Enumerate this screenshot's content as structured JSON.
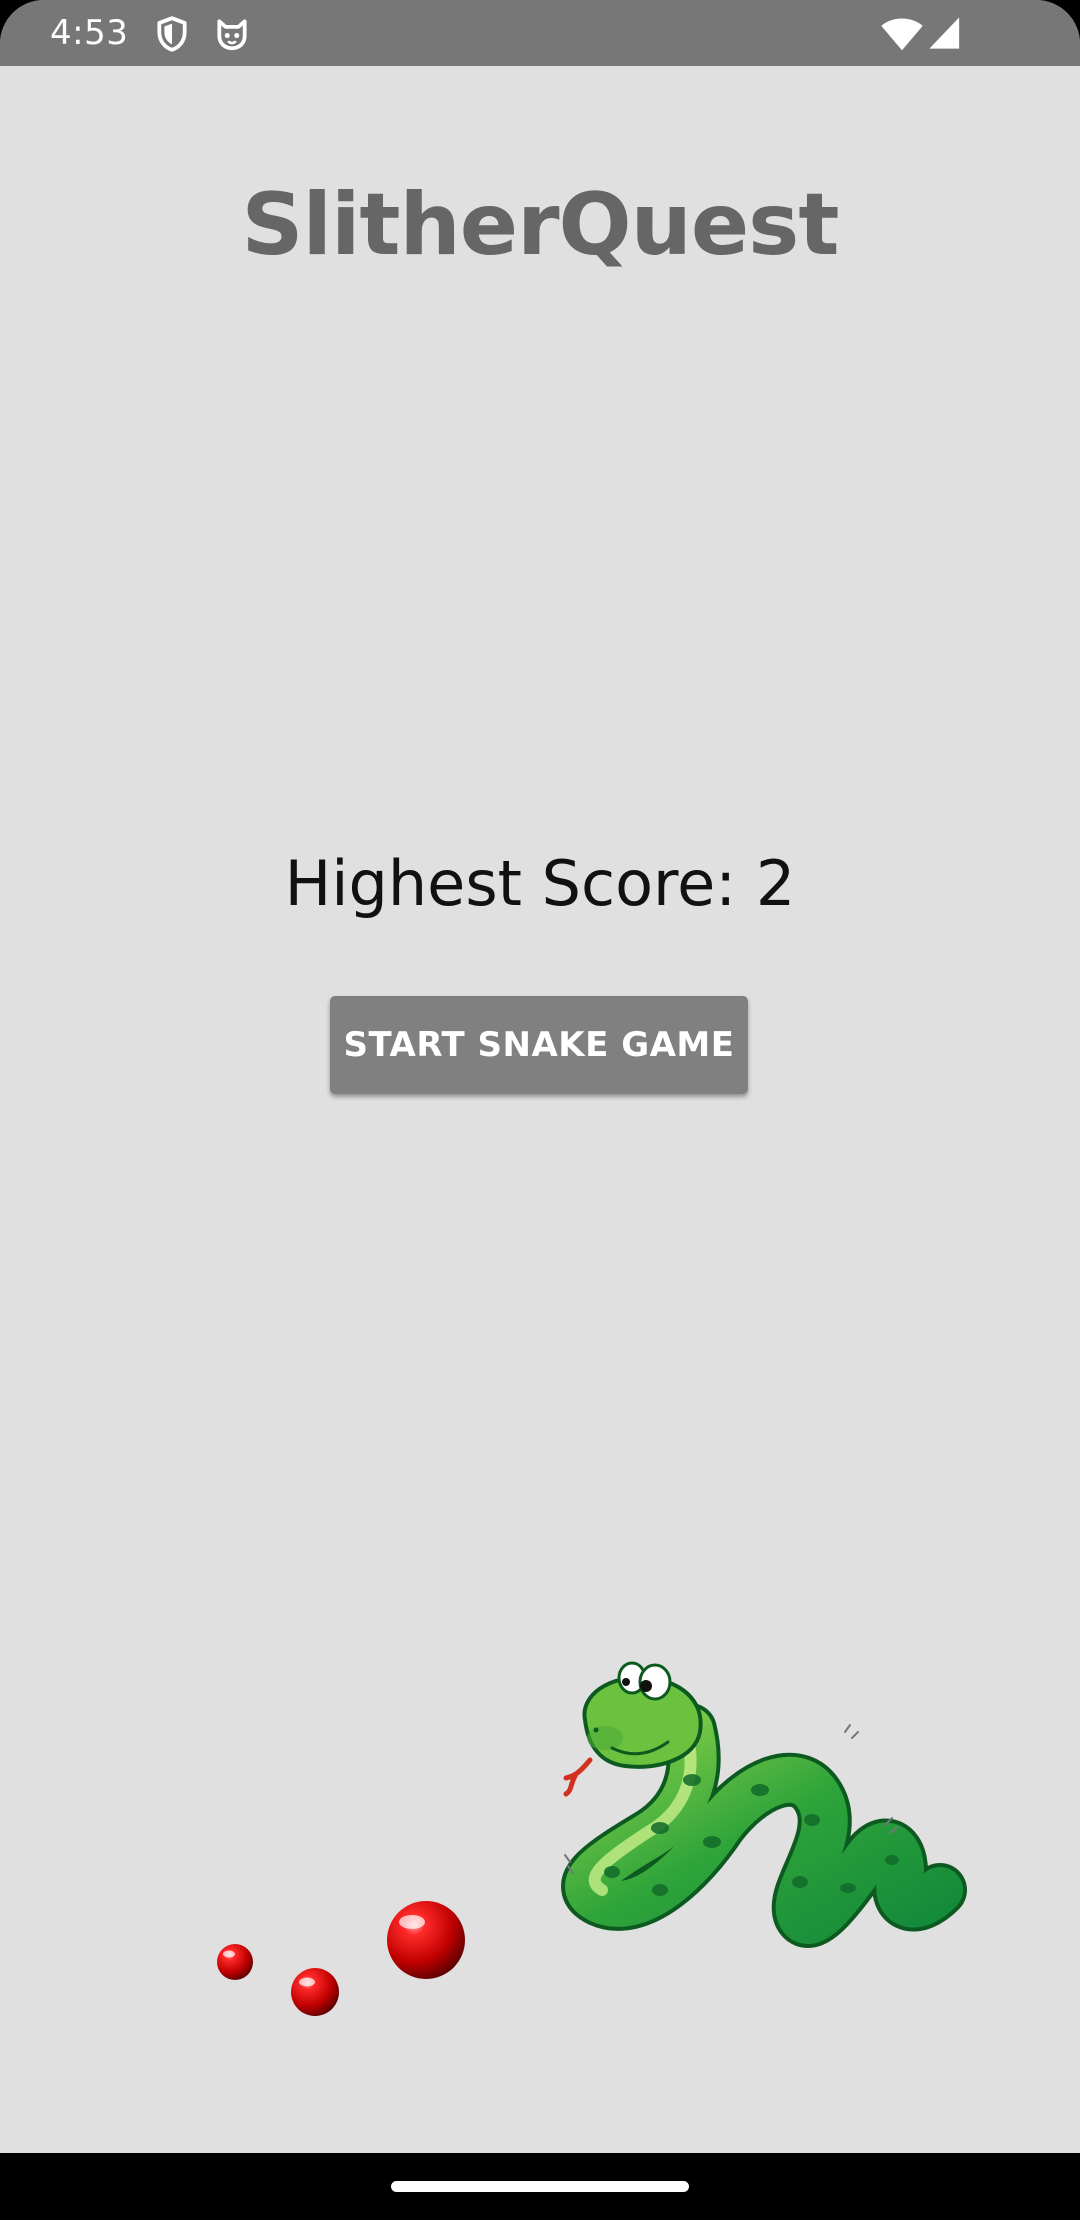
{
  "status_bar": {
    "time": "4:53",
    "icons": [
      "shield-icon",
      "cat-icon",
      "wifi-icon",
      "signal-icon"
    ]
  },
  "app": {
    "title": "SlitherQuest"
  },
  "score": {
    "text": "Highest Score: 2"
  },
  "actions": {
    "start_label": "START SNAKE GAME"
  },
  "artwork": {
    "snake": "green-snake",
    "food": [
      "red-ball",
      "red-ball",
      "red-ball"
    ]
  },
  "colors": {
    "background": "#e0e0e0",
    "status_bar": "#777777",
    "title": "#666666",
    "button": "#808080",
    "snake_green": "#3aa83a",
    "ball_red": "#cc0000"
  }
}
